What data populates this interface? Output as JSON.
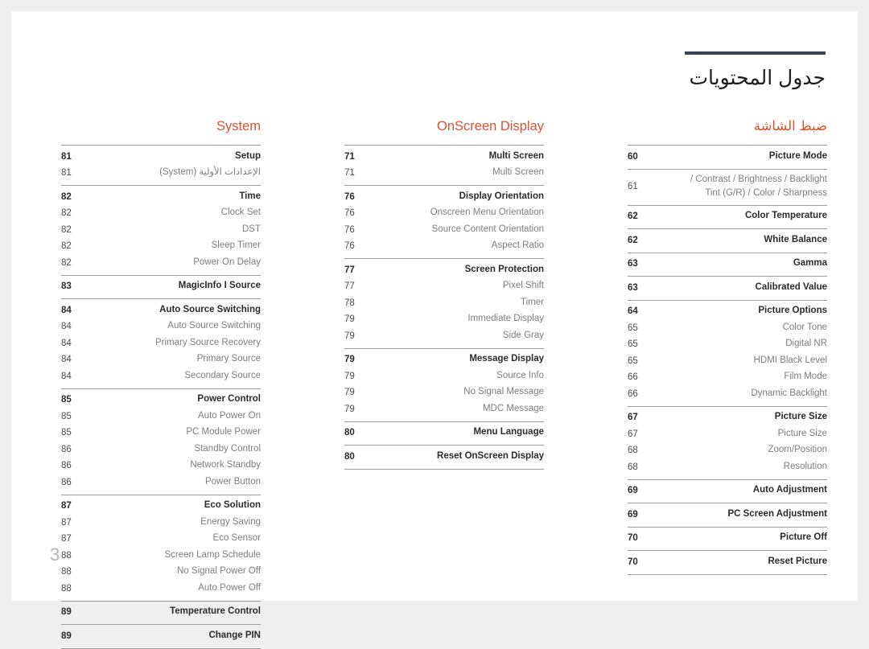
{
  "header": {
    "title": "جدول المحتويات"
  },
  "page_number": "3",
  "columns": {
    "right": {
      "heading": "ضبط الشاشة",
      "groups": [
        {
          "rows": [
            {
              "page": "60",
              "label": "Picture Mode",
              "head": true
            }
          ]
        },
        {
          "rows": [
            {
              "page": "61",
              "label": "/ Contrast / Brightness / Backlight\nTint (G/R) / Color / Sharpness",
              "head": false,
              "multiline": true
            }
          ]
        },
        {
          "rows": [
            {
              "page": "62",
              "label": "Color Temperature",
              "head": true
            }
          ]
        },
        {
          "rows": [
            {
              "page": "62",
              "label": "White Balance",
              "head": true
            }
          ]
        },
        {
          "rows": [
            {
              "page": "63",
              "label": "Gamma",
              "head": true
            }
          ]
        },
        {
          "rows": [
            {
              "page": "63",
              "label": "Calibrated Value",
              "head": true
            }
          ]
        },
        {
          "rows": [
            {
              "page": "64",
              "label": "Picture Options",
              "head": true
            },
            {
              "page": "65",
              "label": "Color Tone",
              "head": false
            },
            {
              "page": "65",
              "label": "Digital NR",
              "head": false
            },
            {
              "page": "65",
              "label": "HDMI Black Level",
              "head": false
            },
            {
              "page": "66",
              "label": "Film Mode",
              "head": false
            },
            {
              "page": "66",
              "label": "Dynamic Backlight",
              "head": false
            }
          ]
        },
        {
          "rows": [
            {
              "page": "67",
              "label": "Picture Size",
              "head": true
            },
            {
              "page": "67",
              "label": "Picture Size",
              "head": false
            },
            {
              "page": "68",
              "label": "Zoom/Position",
              "head": false
            },
            {
              "page": "68",
              "label": "Resolution",
              "head": false
            }
          ]
        },
        {
          "rows": [
            {
              "page": "69",
              "label": "Auto Adjustment",
              "head": true
            }
          ]
        },
        {
          "rows": [
            {
              "page": "69",
              "label": "PC Screen Adjustment",
              "head": true
            }
          ]
        },
        {
          "rows": [
            {
              "page": "70",
              "label": "Picture Off",
              "head": true
            }
          ]
        },
        {
          "rows": [
            {
              "page": "70",
              "label": "Reset Picture",
              "head": true
            }
          ],
          "last": true
        }
      ]
    },
    "middle": {
      "heading": "OnScreen Display",
      "groups": [
        {
          "rows": [
            {
              "page": "71",
              "label": "Multi Screen",
              "head": true
            },
            {
              "page": "71",
              "label": "Multi Screen",
              "head": false
            }
          ]
        },
        {
          "rows": [
            {
              "page": "76",
              "label": "Display Orientation",
              "head": true
            },
            {
              "page": "76",
              "label": "Onscreen Menu Orientation",
              "head": false
            },
            {
              "page": "76",
              "label": "Source Content Orientation",
              "head": false
            },
            {
              "page": "76",
              "label": "Aspect Ratio",
              "head": false
            }
          ]
        },
        {
          "rows": [
            {
              "page": "77",
              "label": "Screen Protection",
              "head": true
            },
            {
              "page": "77",
              "label": "Pixel Shift",
              "head": false
            },
            {
              "page": "78",
              "label": "Timer",
              "head": false
            },
            {
              "page": "79",
              "label": "Immediate Display",
              "head": false
            },
            {
              "page": "79",
              "label": "Side Gray",
              "head": false
            }
          ]
        },
        {
          "rows": [
            {
              "page": "79",
              "label": "Message Display",
              "head": true
            },
            {
              "page": "79",
              "label": "Source Info",
              "head": false
            },
            {
              "page": "79",
              "label": "No Signal Message",
              "head": false
            },
            {
              "page": "79",
              "label": "MDC Message",
              "head": false
            }
          ]
        },
        {
          "rows": [
            {
              "page": "80",
              "label": "Menu Language",
              "head": true
            }
          ]
        },
        {
          "rows": [
            {
              "page": "80",
              "label": "Reset OnScreen Display",
              "head": true
            }
          ],
          "last": true
        }
      ]
    },
    "left": {
      "heading": "System",
      "groups": [
        {
          "rows": [
            {
              "page": "81",
              "label": "Setup",
              "head": true
            },
            {
              "page": "81",
              "label": "الإعدادات الأولية (System)",
              "head": false,
              "rtl": true
            }
          ]
        },
        {
          "rows": [
            {
              "page": "82",
              "label": "Time",
              "head": true
            },
            {
              "page": "82",
              "label": "Clock Set",
              "head": false
            },
            {
              "page": "82",
              "label": "DST",
              "head": false
            },
            {
              "page": "82",
              "label": "Sleep Timer",
              "head": false
            },
            {
              "page": "82",
              "label": "Power On Delay",
              "head": false
            }
          ]
        },
        {
          "rows": [
            {
              "page": "83",
              "label": "MagicInfo I Source",
              "head": true
            }
          ]
        },
        {
          "rows": [
            {
              "page": "84",
              "label": "Auto Source Switching",
              "head": true
            },
            {
              "page": "84",
              "label": "Auto Source Switching",
              "head": false
            },
            {
              "page": "84",
              "label": "Primary Source Recovery",
              "head": false
            },
            {
              "page": "84",
              "label": "Primary Source",
              "head": false
            },
            {
              "page": "84",
              "label": "Secondary Source",
              "head": false
            }
          ]
        },
        {
          "rows": [
            {
              "page": "85",
              "label": "Power Control",
              "head": true
            },
            {
              "page": "85",
              "label": "Auto Power On",
              "head": false
            },
            {
              "page": "85",
              "label": "PC Module Power",
              "head": false
            },
            {
              "page": "86",
              "label": "Standby Control",
              "head": false
            },
            {
              "page": "86",
              "label": "Network Standby",
              "head": false
            },
            {
              "page": "86",
              "label": "Power Button",
              "head": false
            }
          ]
        },
        {
          "rows": [
            {
              "page": "87",
              "label": "Eco Solution",
              "head": true
            },
            {
              "page": "87",
              "label": "Energy Saving",
              "head": false
            },
            {
              "page": "87",
              "label": "Eco Sensor",
              "head": false
            },
            {
              "page": "88",
              "label": "Screen Lamp Schedule",
              "head": false
            },
            {
              "page": "88",
              "label": "No Signal Power Off",
              "head": false
            },
            {
              "page": "88",
              "label": "Auto Power Off",
              "head": false
            }
          ]
        },
        {
          "rows": [
            {
              "page": "89",
              "label": "Temperature Control",
              "head": true
            }
          ]
        },
        {
          "rows": [
            {
              "page": "89",
              "label": "Change PIN",
              "head": true
            }
          ],
          "last": true
        }
      ]
    }
  },
  "colors": {
    "accent": "#d9532c",
    "rule": "#3e4257",
    "separator": "#a0a0a0",
    "page_bg": "#ffffff",
    "canvas_bg": "#efefef"
  }
}
